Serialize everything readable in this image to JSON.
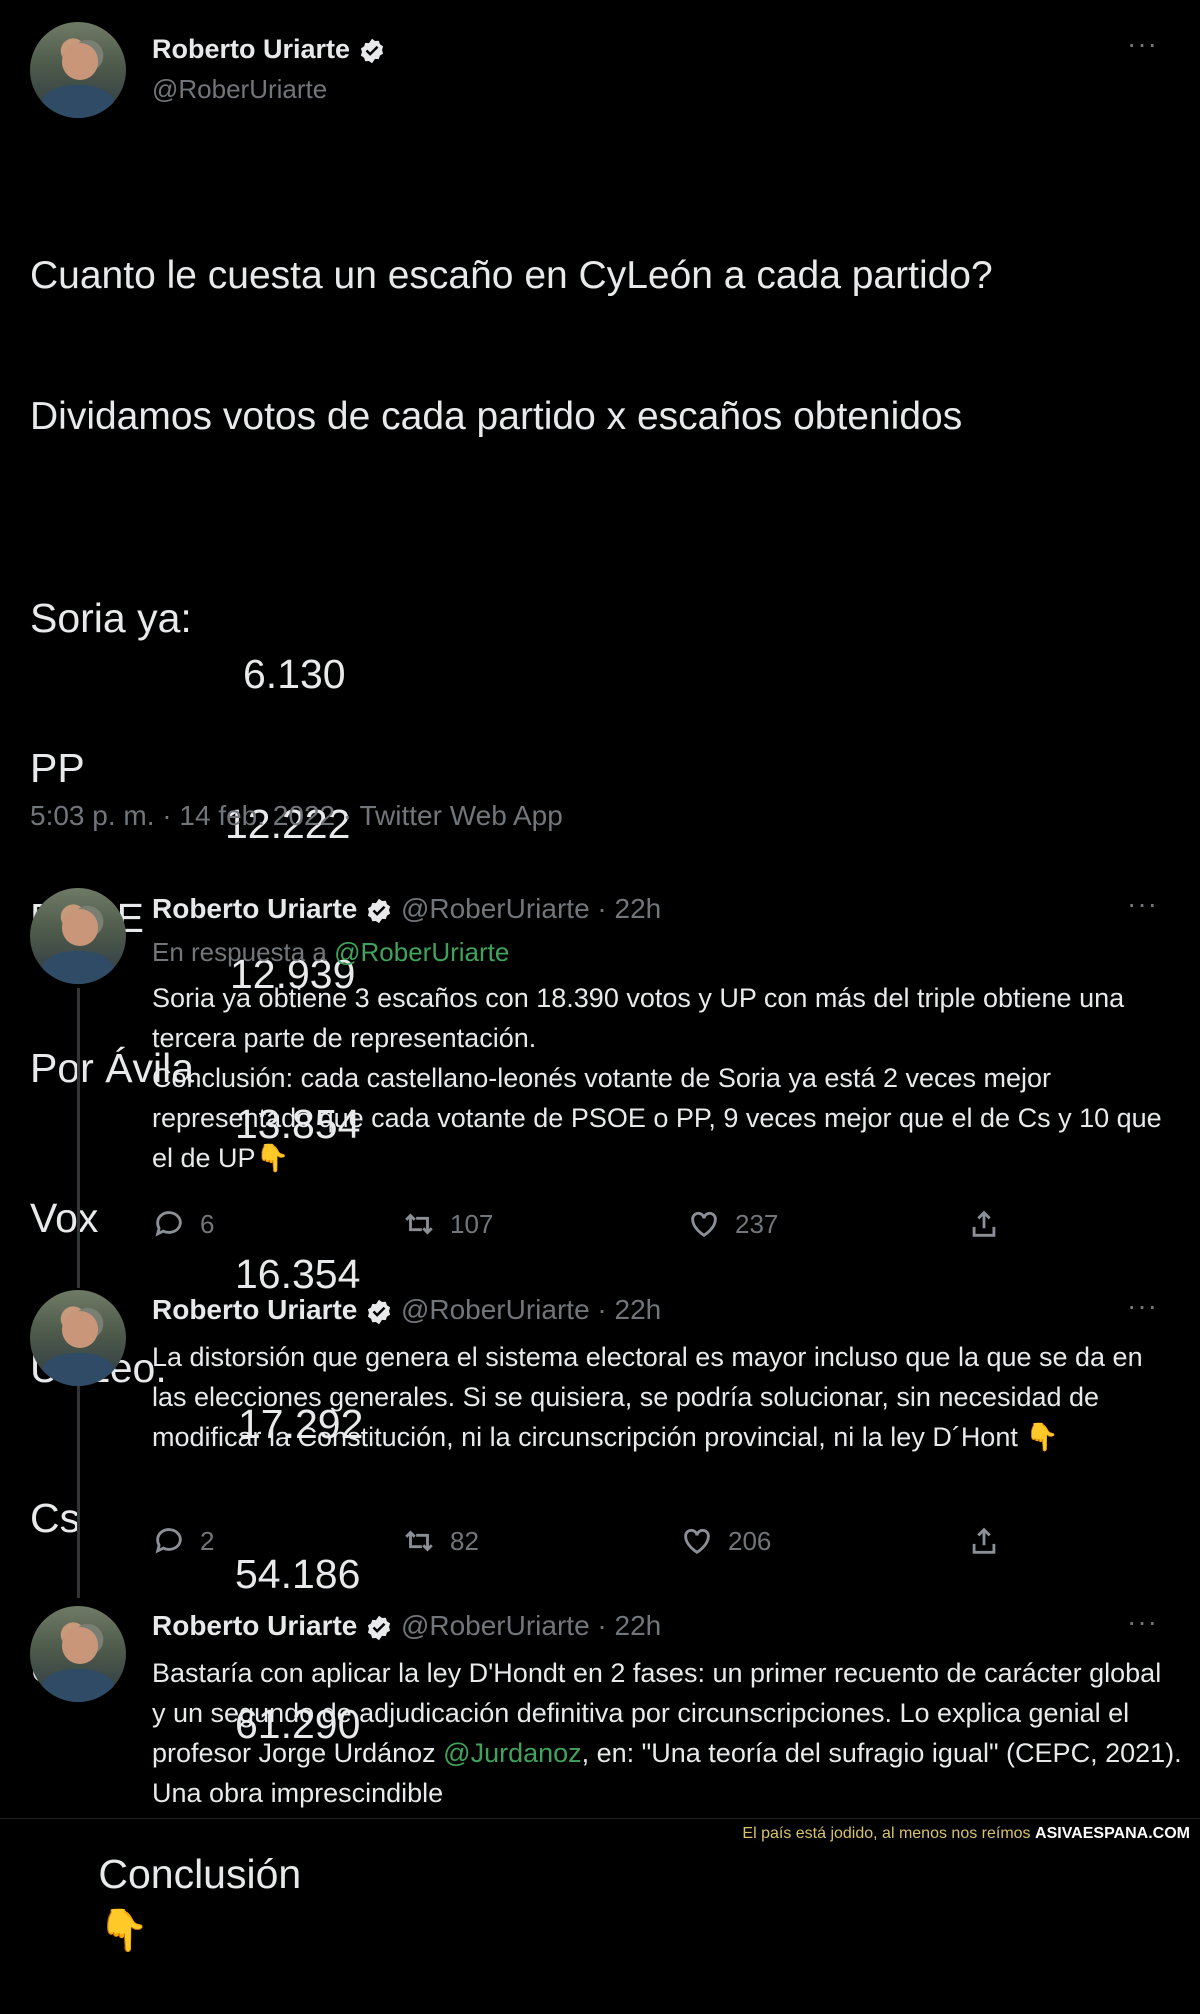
{
  "main_tweet": {
    "name": "Roberto Uriarte",
    "handle": "@RoberUriarte",
    "line1": "Cuanto le cuesta un escaño en CyLeón a cada partido?",
    "line2": "Dividamos votos de cada partido x escaños obtenidos",
    "stats": [
      {
        "party": "Soria ya:",
        "value": "6.130"
      },
      {
        "party": "PP",
        "value": "12.222"
      },
      {
        "party": "PSOE",
        "value": "12.939"
      },
      {
        "party": "Por Ávila",
        "value": "13.854"
      },
      {
        "party": "Vox",
        "value": "16.354"
      },
      {
        "party": "UPLeo.",
        "value": "17.292"
      },
      {
        "party": "Cs",
        "value": "54.186"
      },
      {
        "party": "UP:",
        "value": "61.290"
      }
    ],
    "conclusion": "Conclusión",
    "emoji": "👇",
    "meta": "5:03 p. m. · 14 feb. 2022 · Twitter Web App"
  },
  "replies": [
    {
      "name": "Roberto Uriarte",
      "handle": "@RoberUriarte",
      "time": "· 22h",
      "reply_to_prefix": "En respuesta a ",
      "reply_to_handle": "@RoberUriarte",
      "text": "Soria ya obtiene 3 escaños con 18.390 votos y UP con más del triple obtiene una tercera parte de representación.\nConclusión: cada castellano-leonés votante de Soria ya está 2 veces mejor representado que cada votante de PSOE o PP, 9 veces mejor que el de Cs y 10 que el de UP👇",
      "replies": "6",
      "retweets": "107",
      "likes": "237"
    },
    {
      "name": "Roberto Uriarte",
      "handle": "@RoberUriarte",
      "time": "· 22h",
      "text": "La distorsión que genera el sistema electoral es mayor incluso que la que se da en las elecciones generales. Si se quisiera, se podría solucionar, sin necesidad de modificar la Constitución, ni la circunscripción provincial, ni la ley D´Hont 👇",
      "replies": "2",
      "retweets": "82",
      "likes": "206"
    },
    {
      "name": "Roberto Uriarte",
      "handle": "@RoberUriarte",
      "time": "· 22h",
      "text_before": "Bastaría con aplicar la ley D'Hondt en 2 fases: un primer recuento de carácter global y un segundo de adjudicación definitiva por circunscripciones. Lo explica genial el profesor Jorge Urdánoz ",
      "mention": "@Jurdanoz",
      "text_after": ", en: \"Una teoría del sufragio igual\" (CEPC, 2021). Una obra imprescindible"
    }
  ],
  "footer": {
    "tagline": "El país está jodido, al menos nos reímos",
    "site": "ASIVAESPANA.COM"
  },
  "colors": {
    "background": "#000000",
    "text": "#e7e9ea",
    "muted": "#71767b",
    "link": "#1d9bf0",
    "verified": "#e7e9ea"
  }
}
